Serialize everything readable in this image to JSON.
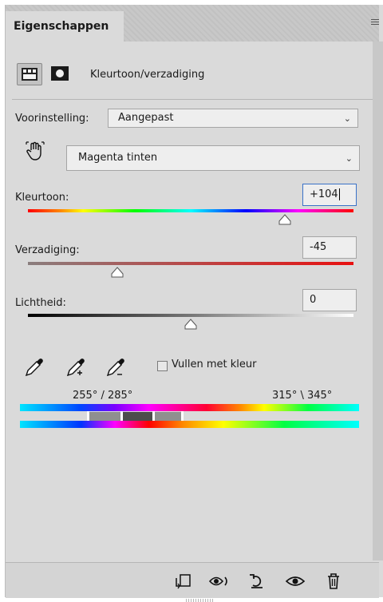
{
  "panel": {
    "tab_label": "Eigenschappen",
    "menu_icon": "panel-menu-icon",
    "adjustment_title": "Kleurtoon/verzadiging"
  },
  "preset": {
    "label": "Voorinstelling:",
    "value": "Aangepast"
  },
  "channel": {
    "value": "Magenta tinten"
  },
  "sliders": {
    "hue": {
      "label": "Kleurtoon:",
      "value": "+104",
      "level": 0.7889
    },
    "saturation": {
      "label": "Verzadiging:",
      "value": "-45",
      "level": 0.275
    },
    "lightness": {
      "label": "Lichtheid:",
      "value": "0",
      "level": 0.5
    }
  },
  "colorize": {
    "label": "Vullen met kleur",
    "checked": false
  },
  "range": {
    "left": "255° / 285°",
    "right": "315° \\ 345°"
  },
  "toolbar": {
    "icons": [
      "clip-to-layer-icon",
      "view-previous-icon",
      "reset-icon",
      "visibility-icon",
      "delete-icon"
    ]
  }
}
